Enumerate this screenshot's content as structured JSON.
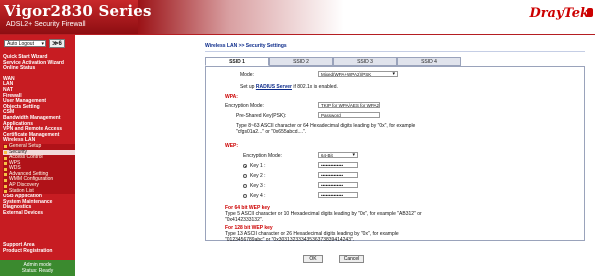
{
  "header": {
    "product": "Vigor2830 Series",
    "subtitle": "ADSL2+ Security Firewall",
    "logo": "DrayTek"
  },
  "sidebar": {
    "logout_select": "Auto Logout",
    "go_label": "≫6",
    "groups": [
      {
        "label": "Quick Start Wizard"
      },
      {
        "label": "Service Activation Wizard"
      },
      {
        "label": "Online Status"
      },
      {
        "label": "WAN"
      },
      {
        "label": "LAN"
      },
      {
        "label": "NAT"
      },
      {
        "label": "Firewall"
      },
      {
        "label": "User Management"
      },
      {
        "label": "Objects Setting"
      },
      {
        "label": "CSM"
      },
      {
        "label": "Bandwidth Management"
      },
      {
        "label": "Applications"
      },
      {
        "label": "VPN and Remote Access"
      },
      {
        "label": "Certificate Management"
      },
      {
        "label": "Wireless LAN"
      }
    ],
    "wlan_sub": [
      "General Setup",
      "Security",
      "Access Control",
      "WPS",
      "WDS",
      "Advanced Setting",
      "WMM Configuration",
      "AP Discovery",
      "Station List"
    ],
    "groups2": [
      {
        "label": "USB Application"
      },
      {
        "label": "System Maintenance"
      },
      {
        "label": "Diagnostics"
      },
      {
        "label": "External Devices"
      }
    ],
    "support_area": "Support Area",
    "product_registration": "Product Registration",
    "status_line1": "Admin mode",
    "status_line2": "Status: Ready"
  },
  "main": {
    "breadcrumb": "Wireless LAN >> Security Settings",
    "tabs": [
      "SSID 1",
      "SSID 2",
      "SSID 3",
      "SSID 4"
    ],
    "active_tab": 0,
    "mode_label": "Mode:",
    "mode_value": "Mixed(WPA+WPA2)/PSK",
    "radius_prefix": "Set up ",
    "radius_link": "RADIUS Server",
    "radius_suffix": " if 802.1x is enabled.",
    "wpa_heading": "WPA:",
    "encryption_mode_label": "Encryption Mode:",
    "encryption_mode_value": "TKIP for WPA/AES for WPA2",
    "psk_label": "Pre-Shared Key(PSK):",
    "psk_value": "Password",
    "psk_hint_line1": "Type 8~63 ASCII character or 64 Hexadecimal digits leading by \"0x\", for example",
    "psk_hint_line2": "\"cfgs01a2...\" or \"0x655abcd....\".",
    "wep_heading": "WEP:",
    "wep_enc_label": "Encryption Mode:",
    "wep_enc_value": "64-Bit",
    "keys": [
      {
        "label": "Key 1 :",
        "value": "••••••••••••••",
        "selected": true
      },
      {
        "label": "Key 2 :",
        "value": "••••••••••••••",
        "selected": false
      },
      {
        "label": "Key 3 :",
        "value": "••••••••••••••",
        "selected": false
      },
      {
        "label": "Key 4 :",
        "value": "••••••••••••••",
        "selected": false
      }
    ],
    "wep64_heading": "For 64 bit WEP key",
    "wep64_line1": "Type 5 ASCII character or 10 Hexadecimal digits leading by \"0x\", for example \"AB312\" or",
    "wep64_line2": "\"0x4142333132\".",
    "wep128_heading": "For 128 bit WEP key",
    "wep128_line1": "Type 13 ASCII character or 26 Hexadecimal digits leading by \"0x\", for example",
    "wep128_line2": "\"0123456789abc\" or \"0x30313233343536373839414243\".",
    "ok_label": "OK",
    "cancel_label": "Cancel"
  },
  "colors": {
    "brand_red": "#c71c22",
    "status_green": "#3b8a2f",
    "link_blue": "#0b2a8a"
  }
}
